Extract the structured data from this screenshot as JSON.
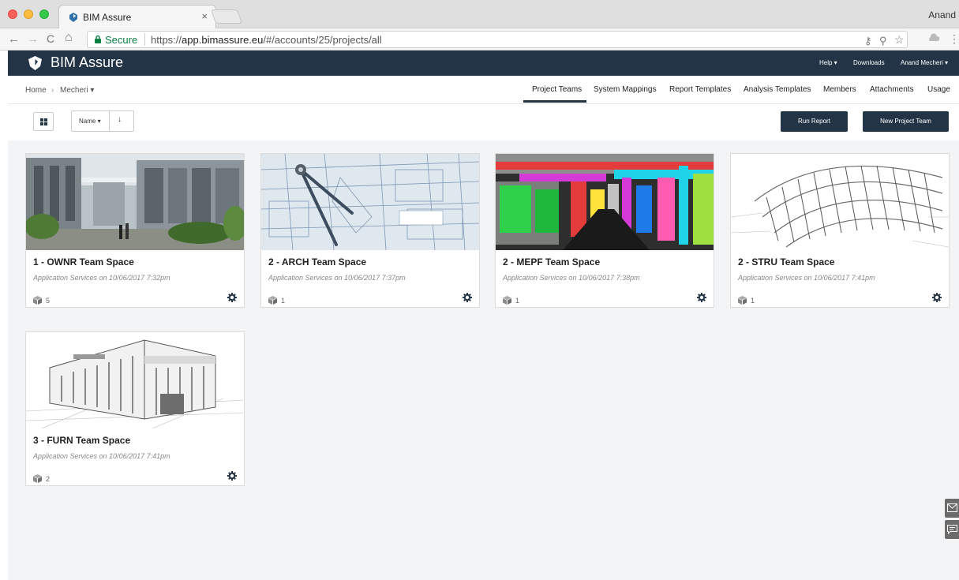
{
  "browser": {
    "tab_title": "BIM Assure",
    "tab_close": "×",
    "profile_name": "Anand",
    "secure_label": "Secure",
    "url_scheme": "https://",
    "url_host": "app.bimassure.eu",
    "url_path": "/#/accounts/25/projects/all",
    "nav_back": "←",
    "nav_forward": "→",
    "nav_reload": "C",
    "nav_home": "⌂",
    "icon_key": "⚷",
    "icon_zoom": "⚲",
    "icon_star": "☆",
    "icon_menu": "⋮"
  },
  "app": {
    "brand": "BIM Assure",
    "nav": {
      "help": "Help ▾",
      "downloads": "Downloads",
      "user": "Anand Mecheri ▾"
    }
  },
  "breadcrumb": {
    "home": "Home",
    "separator": "›",
    "account": "Mecheri ▾"
  },
  "tabs": [
    {
      "label": "Project Teams",
      "active": true
    },
    {
      "label": "System Mappings"
    },
    {
      "label": "Report Templates"
    },
    {
      "label": "Analysis Templates"
    },
    {
      "label": "Members"
    },
    {
      "label": "Attachments"
    },
    {
      "label": "Usage"
    }
  ],
  "toolbar": {
    "sort_label": "Name ▾",
    "sort_direction": "↓",
    "run_report": "Run Report",
    "new_team": "New Project Team"
  },
  "cards": [
    {
      "title": "1 - OWNR Team Space",
      "meta": "Application Services on 10/06/2017 7:32pm",
      "count": "5"
    },
    {
      "title": "2 - ARCH Team Space",
      "meta": "Application Services on 10/06/2017 7:37pm",
      "count": "1"
    },
    {
      "title": "2 - MEPF Team Space",
      "meta": "Application Services on 10/06/2017 7:38pm",
      "count": "1"
    },
    {
      "title": "2 - STRU Team Space",
      "meta": "Application Services on 10/06/2017 7:41pm",
      "count": "1"
    },
    {
      "title": "3 - FURN Team Space",
      "meta": "Application Services on 10/06/2017 7:41pm",
      "count": "2"
    }
  ],
  "colors": {
    "header_bg": "#243447",
    "page_bg": "#f3f4f5",
    "secure_green": "#0b8043"
  }
}
